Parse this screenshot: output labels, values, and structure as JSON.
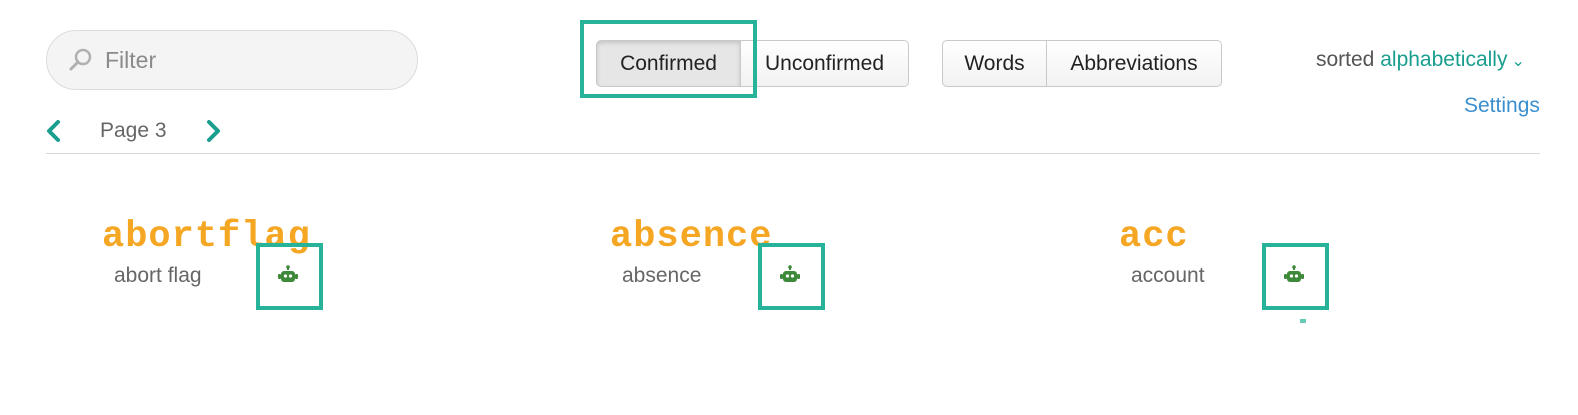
{
  "filter": {
    "placeholder": "Filter",
    "value": ""
  },
  "status_toggle": {
    "confirmed_label": "Confirmed",
    "unconfirmed_label": "Unconfirmed",
    "active": "confirmed"
  },
  "type_toggle": {
    "words_label": "Words",
    "abbreviations_label": "Abbreviations"
  },
  "sort": {
    "prefix": "sorted",
    "mode": "alphabetically"
  },
  "settings_label": "Settings",
  "pager": {
    "label": "Page 3"
  },
  "entries": [
    {
      "word": "abortflag",
      "expansion": "abort flag",
      "icon": "robot-icon"
    },
    {
      "word": "absence",
      "expansion": "absence",
      "icon": "robot-icon"
    },
    {
      "word": "acc",
      "expansion": "account",
      "icon": "robot-icon"
    }
  ],
  "colors": {
    "accent": "#26b39a",
    "word": "#f5a623",
    "link": "#1a9e8f",
    "robot": "#3f8a3a"
  }
}
